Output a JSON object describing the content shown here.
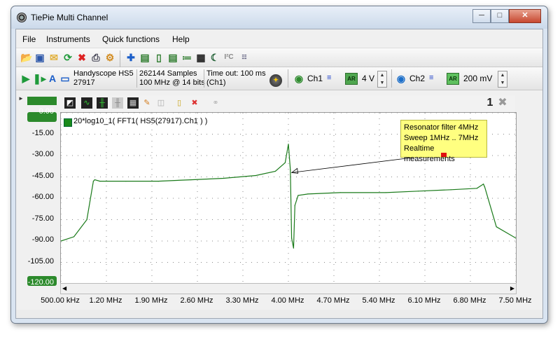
{
  "window": {
    "title": "TiePie Multi Channel"
  },
  "menu": [
    "File",
    "Instruments",
    "Quick functions",
    "Help"
  ],
  "instrument": {
    "name": "Handyscope HS5",
    "serial": "27917",
    "samples": "262144 Samples",
    "rate": "100 MHz @ 14 bits",
    "timeout": "Time out: 100 ms",
    "timeout_ch": "(Ch1)"
  },
  "channels": [
    {
      "label": "Ch1",
      "ar": "AR",
      "range": "4 V"
    },
    {
      "label": "Ch2",
      "ar": "AR",
      "range": "200 mV"
    }
  ],
  "plot": {
    "trace_label": "20*log10_1( FFT1( HS5(27917).Ch1 ) )",
    "page_number": "1",
    "annotation": [
      "Resonator filter 4MHz",
      "Sweep 1MHz .. 7MHz",
      "Realtime measurements"
    ]
  },
  "colors": {
    "trace": "#1a7a1a",
    "accent": "#2e8b2e"
  },
  "chart_data": {
    "type": "line",
    "title": "",
    "xlabel": "",
    "ylabel": "",
    "y_ticks": [
      "0.00",
      "-15.00",
      "-30.00",
      "-45.00",
      "-60.00",
      "-75.00",
      "-90.00",
      "-105.00",
      "-120.00"
    ],
    "x_ticks": [
      "500.00 kHz",
      "1.20 MHz",
      "1.90 MHz",
      "2.60 MHz",
      "3.30 MHz",
      "4.00 MHz",
      "4.70 MHz",
      "5.40 MHz",
      "6.10 MHz",
      "6.80 MHz",
      "7.50 MHz"
    ],
    "xlim": [
      0.5,
      7.5
    ],
    "ylim": [
      -120,
      0
    ],
    "grid": true,
    "series": [
      {
        "x": [
          0.5,
          0.7,
          0.9,
          1.0,
          1.02,
          1.1,
          1.5,
          2.0,
          2.5,
          3.0,
          3.5,
          3.8,
          3.95,
          4.0,
          4.03,
          4.05,
          4.08,
          4.1,
          4.15,
          4.3,
          4.8,
          5.5,
          6.0,
          6.5,
          6.9,
          7.0,
          7.02,
          7.2,
          7.5
        ],
        "y": [
          -90,
          -87,
          -75,
          -48,
          -47,
          -48,
          -48,
          -48,
          -47,
          -46,
          -44,
          -41,
          -35,
          -22,
          -40,
          -88,
          -95,
          -65,
          -58,
          -57,
          -56,
          -56,
          -55,
          -54,
          -53,
          -50,
          -52,
          -80,
          -88
        ]
      }
    ]
  }
}
